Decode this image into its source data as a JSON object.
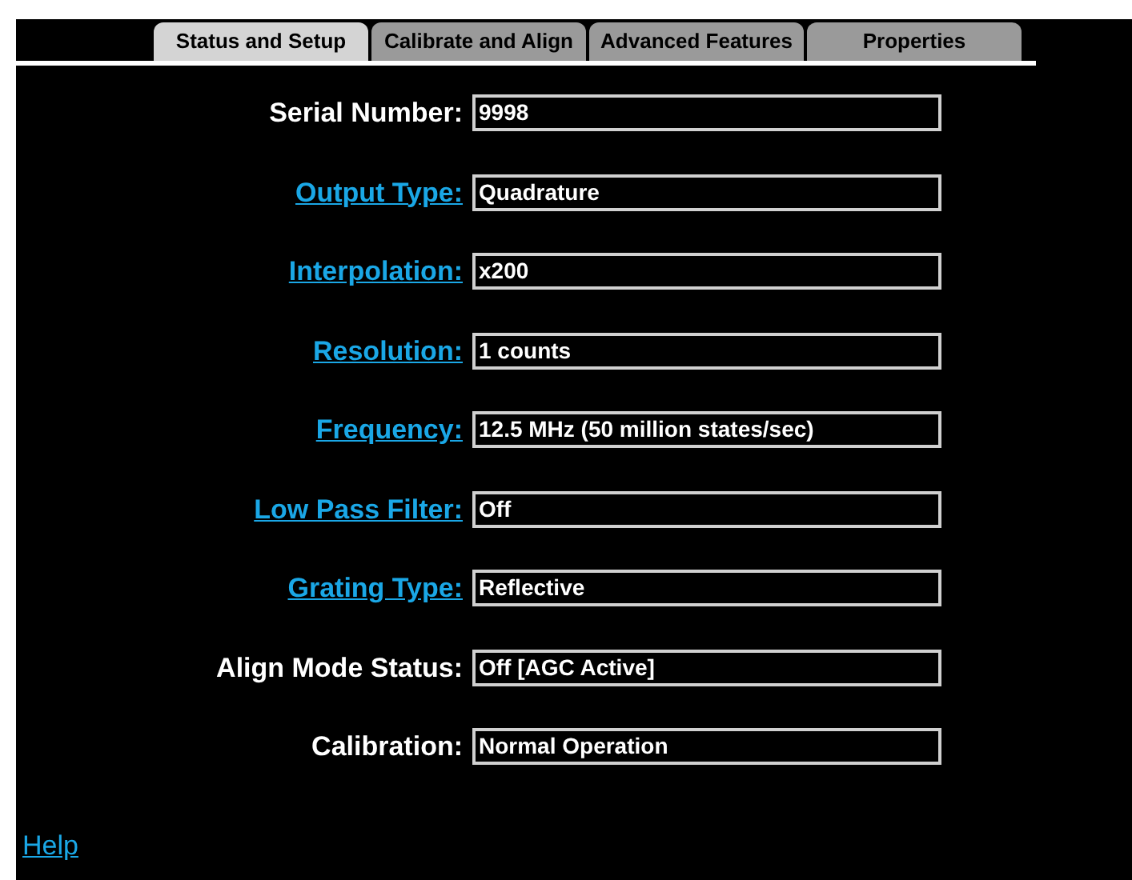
{
  "tabs": [
    {
      "label": "Status and Setup",
      "selected": true
    },
    {
      "label": "Calibrate and Align",
      "selected": false
    },
    {
      "label": "Advanced Features",
      "selected": false
    },
    {
      "label": "Properties",
      "selected": false
    }
  ],
  "fields": [
    {
      "label": "Serial Number:",
      "link": false,
      "value": "9998"
    },
    {
      "label": "Output Type:",
      "link": true,
      "value": "Quadrature"
    },
    {
      "label": "Interpolation:",
      "link": true,
      "value": "x200"
    },
    {
      "label": "Resolution:",
      "link": true,
      "value": "1 counts"
    },
    {
      "label": "Frequency:",
      "link": true,
      "value": "12.5 MHz (50 million states/sec)"
    },
    {
      "label": "Low Pass Filter:",
      "link": true,
      "value": "Off"
    },
    {
      "label": "Grating Type:",
      "link": true,
      "value": "Reflective"
    },
    {
      "label": "Align Mode Status:",
      "link": false,
      "value": "Off [AGC Active]"
    },
    {
      "label": "Calibration:",
      "link": false,
      "value": "Normal Operation"
    }
  ],
  "help_link": "Help"
}
